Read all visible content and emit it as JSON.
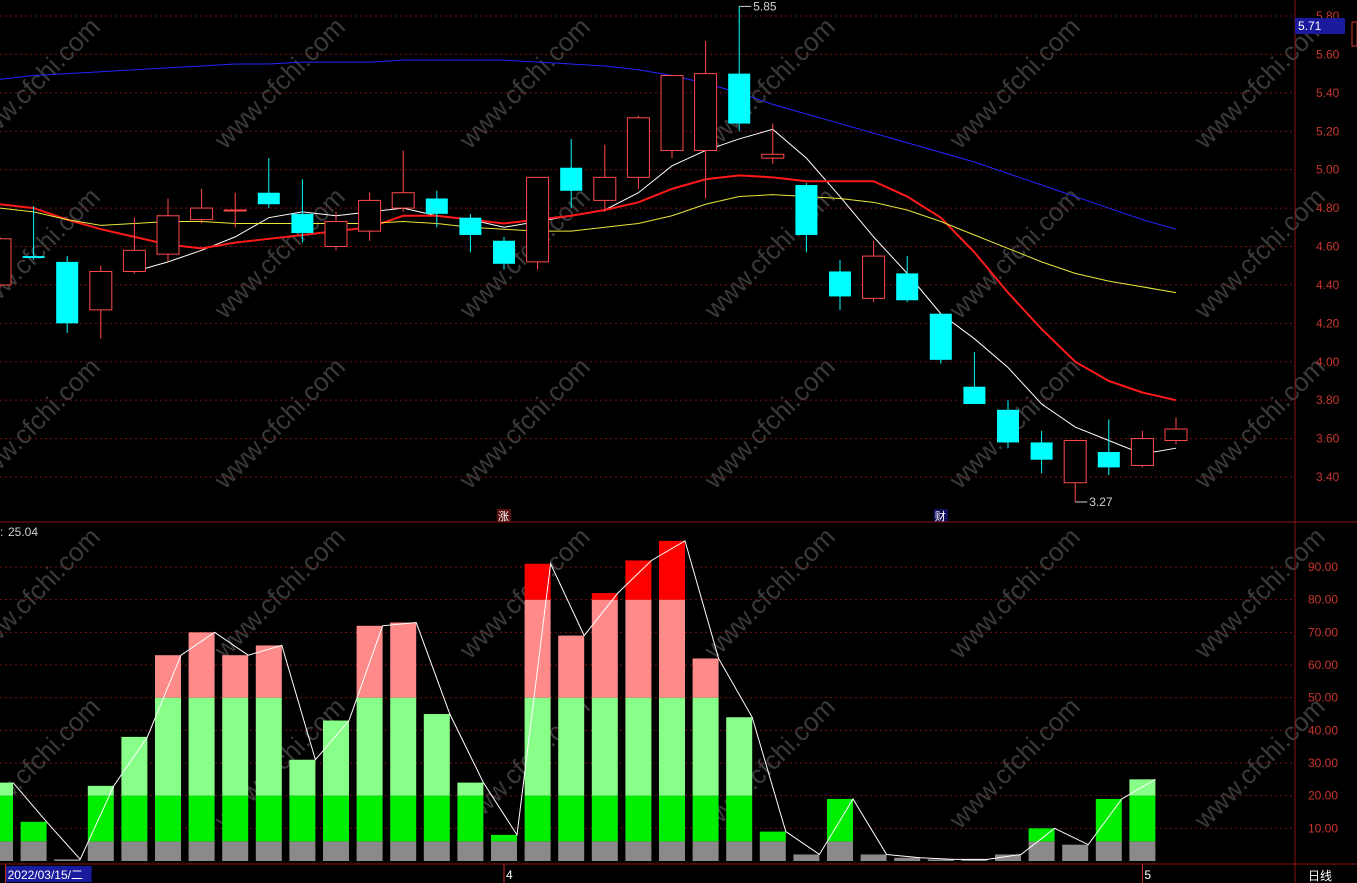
{
  "app": {
    "timeframe_label": "日线"
  },
  "chart_data": [
    {
      "type": "candlestick",
      "name_hint": "",
      "ylim": [
        3.2,
        5.85
      ],
      "yticks": [
        "5.80",
        "5.60",
        "5.40",
        "5.20",
        "5.00",
        "4.80",
        "4.60",
        "4.40",
        "4.20",
        "4.00",
        "3.80",
        "3.60",
        "3.40"
      ],
      "current_price": "5.71",
      "max_label": "5.85",
      "min_label": "3.27",
      "event_markers": [
        {
          "text": "涨",
          "index": 15
        },
        {
          "text": "财",
          "index": 28
        }
      ],
      "candles": [
        {
          "o": 4.4,
          "h": 4.65,
          "l": 4.38,
          "c": 4.64
        },
        {
          "o": 4.55,
          "h": 4.81,
          "l": 4.53,
          "c": 4.54
        },
        {
          "o": 4.52,
          "h": 4.55,
          "l": 4.15,
          "c": 4.2
        },
        {
          "o": 4.27,
          "h": 4.5,
          "l": 4.12,
          "c": 4.47
        },
        {
          "o": 4.47,
          "h": 4.75,
          "l": 4.46,
          "c": 4.58
        },
        {
          "o": 4.56,
          "h": 4.85,
          "l": 4.52,
          "c": 4.76
        },
        {
          "o": 4.74,
          "h": 4.9,
          "l": 4.72,
          "c": 4.8
        },
        {
          "o": 4.79,
          "h": 4.88,
          "l": 4.7,
          "c": 4.79
        },
        {
          "o": 4.88,
          "h": 5.06,
          "l": 4.8,
          "c": 4.82
        },
        {
          "o": 4.77,
          "h": 4.95,
          "l": 4.62,
          "c": 4.67
        },
        {
          "o": 4.6,
          "h": 4.78,
          "l": 4.58,
          "c": 4.73
        },
        {
          "o": 4.68,
          "h": 4.88,
          "l": 4.63,
          "c": 4.84
        },
        {
          "o": 4.8,
          "h": 5.1,
          "l": 4.78,
          "c": 4.88
        },
        {
          "o": 4.85,
          "h": 4.89,
          "l": 4.7,
          "c": 4.77
        },
        {
          "o": 4.75,
          "h": 4.77,
          "l": 4.57,
          "c": 4.66
        },
        {
          "o": 4.63,
          "h": 4.65,
          "l": 4.48,
          "c": 4.51
        },
        {
          "o": 4.52,
          "h": 4.96,
          "l": 4.48,
          "c": 4.96
        },
        {
          "o": 5.01,
          "h": 5.16,
          "l": 4.8,
          "c": 4.89
        },
        {
          "o": 4.84,
          "h": 5.13,
          "l": 4.78,
          "c": 4.96
        },
        {
          "o": 4.96,
          "h": 5.28,
          "l": 4.9,
          "c": 5.27
        },
        {
          "o": 5.1,
          "h": 5.47,
          "l": 5.06,
          "c": 5.49
        },
        {
          "o": 5.1,
          "h": 5.67,
          "l": 4.85,
          "c": 5.5
        },
        {
          "o": 5.5,
          "h": 5.85,
          "l": 5.2,
          "c": 5.24
        },
        {
          "o": 5.06,
          "h": 5.24,
          "l": 5.03,
          "c": 5.08
        },
        {
          "o": 4.92,
          "h": 4.93,
          "l": 4.57,
          "c": 4.66
        },
        {
          "o": 4.47,
          "h": 4.53,
          "l": 4.27,
          "c": 4.34
        },
        {
          "o": 4.33,
          "h": 4.63,
          "l": 4.31,
          "c": 4.55
        },
        {
          "o": 4.46,
          "h": 4.55,
          "l": 4.31,
          "c": 4.32
        },
        {
          "o": 4.25,
          "h": 4.25,
          "l": 3.99,
          "c": 4.01
        },
        {
          "o": 3.87,
          "h": 4.05,
          "l": 3.86,
          "c": 3.78
        },
        {
          "o": 3.75,
          "h": 3.8,
          "l": 3.55,
          "c": 3.58
        },
        {
          "o": 3.58,
          "h": 3.64,
          "l": 3.42,
          "c": 3.49
        },
        {
          "o": 3.37,
          "h": 3.58,
          "l": 3.27,
          "c": 3.59
        },
        {
          "o": 3.53,
          "h": 3.7,
          "l": 3.41,
          "c": 3.45
        },
        {
          "o": 3.46,
          "h": 3.64,
          "l": 3.45,
          "c": 3.6
        },
        {
          "o": 3.59,
          "h": 3.71,
          "l": 3.57,
          "c": 3.65
        }
      ],
      "ma_lines": [
        {
          "color": "#ffffff",
          "values": [
            null,
            null,
            null,
            null,
            4.47,
            4.52,
            4.58,
            4.65,
            4.75,
            4.78,
            4.76,
            4.78,
            4.8,
            4.76,
            4.74,
            4.7,
            4.73,
            4.76,
            4.79,
            4.88,
            5.02,
            5.1,
            5.16,
            5.21,
            5.06,
            4.86,
            4.65,
            4.46,
            4.25,
            4.12,
            3.97,
            3.78,
            3.66,
            3.59,
            3.52,
            3.55
          ]
        },
        {
          "color": "#ff1a1a",
          "values": [
            4.82,
            4.8,
            4.74,
            4.69,
            4.65,
            4.61,
            4.59,
            4.62,
            4.64,
            4.66,
            4.68,
            4.7,
            4.76,
            4.76,
            4.74,
            4.72,
            4.74,
            4.76,
            4.79,
            4.83,
            4.9,
            4.95,
            4.97,
            4.96,
            4.94,
            4.94,
            4.94,
            4.86,
            4.75,
            4.57,
            4.36,
            4.17,
            4.0,
            3.9,
            3.84,
            3.8
          ]
        },
        {
          "color": "#e8e83a",
          "values": [
            4.8,
            4.78,
            4.74,
            4.71,
            4.72,
            4.73,
            4.73,
            4.72,
            4.72,
            4.72,
            4.72,
            4.72,
            4.73,
            4.72,
            4.7,
            4.69,
            4.68,
            4.68,
            4.7,
            4.72,
            4.76,
            4.82,
            4.86,
            4.87,
            4.86,
            4.85,
            4.83,
            4.79,
            4.73,
            4.66,
            4.59,
            4.52,
            4.46,
            4.42,
            4.39,
            4.36
          ]
        },
        {
          "color": "#2424ff",
          "values": [
            5.47,
            5.49,
            5.5,
            5.51,
            5.52,
            5.53,
            5.54,
            5.55,
            5.55,
            5.56,
            5.56,
            5.56,
            5.57,
            5.57,
            5.57,
            5.57,
            5.56,
            5.55,
            5.54,
            5.52,
            5.49,
            5.45,
            5.4,
            5.34,
            5.29,
            5.24,
            5.19,
            5.14,
            5.09,
            5.04,
            4.98,
            4.92,
            4.86,
            4.8,
            4.74,
            4.69
          ]
        }
      ]
    },
    {
      "type": "bar",
      "indicator_value": "25.04",
      "ylim": [
        0,
        100
      ],
      "yticks": [
        "90.00",
        "80.00",
        "70.00",
        "60.00",
        "50.00",
        "40.00",
        "30.00",
        "20.00",
        "10.00"
      ],
      "values": [
        24,
        12,
        0.5,
        23,
        38,
        63,
        70,
        63,
        66,
        31,
        43,
        72,
        73,
        45,
        24,
        8,
        91,
        69,
        82,
        92,
        98,
        62,
        44,
        9,
        2,
        19,
        2,
        1,
        0.5,
        0.5,
        2,
        10,
        5,
        19,
        25
      ],
      "color_bands": [
        {
          "from": 0,
          "to": 6,
          "color": "#8a8a8a"
        },
        {
          "from": 6,
          "to": 20,
          "color": "#00ee00"
        },
        {
          "from": 20,
          "to": 50,
          "color": "#88ff88"
        },
        {
          "from": 50,
          "to": 80,
          "color": "#ff8a8a"
        },
        {
          "from": 80,
          "to": 100,
          "color": "#ff0000"
        }
      ]
    }
  ],
  "xaxis": {
    "labels": [
      "2022/03/15/二",
      "4",
      "5"
    ],
    "label_index": [
      1,
      15,
      34
    ]
  },
  "watermark": "www.cfchi.com"
}
